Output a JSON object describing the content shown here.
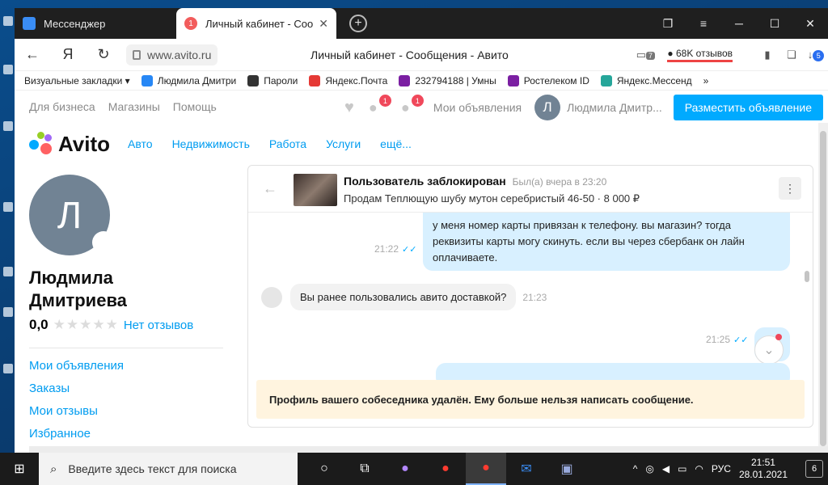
{
  "browser": {
    "tabs": [
      {
        "label": "Мессенджер"
      },
      {
        "label": "Личный кабинет - Coo",
        "badge": "1"
      }
    ],
    "url": "www.avito.ru",
    "yandex_glyph": "Я",
    "page_title": "Личный кабинет - Сообщения - Авито",
    "reviews_badge": "68K отзывов",
    "ext_badge": "7",
    "downloads_badge": "5",
    "bookmarks": [
      {
        "label": "Визуальные закладки ▾",
        "color": ""
      },
      {
        "label": "Людмила Дмитри",
        "color": "#2787f5"
      },
      {
        "label": "Пароли",
        "color": "#333333"
      },
      {
        "label": "Яндекс.Почта",
        "color": "#e53935"
      },
      {
        "label": "232794188 | Умны",
        "color": "#7b1fa2"
      },
      {
        "label": "Ростелеком ID",
        "color": "#7b1fa2"
      },
      {
        "label": "Яндекс.Мессенд",
        "color": "#26a69a"
      }
    ]
  },
  "avito": {
    "top_links": [
      "Для бизнеса",
      "Магазины",
      "Помощь"
    ],
    "notif_badge": "1",
    "msg_badge": "1",
    "my_ads": "Мои объявления",
    "user_initial": "Л",
    "user_name": "Людмила Дмитр...",
    "post_button": "Разместить объявление",
    "logo_text": "Avito",
    "nav": [
      "Авто",
      "Недвижимость",
      "Работа",
      "Услуги",
      "ещё..."
    ],
    "profile": {
      "initial": "Л",
      "name_line1": "Людмила",
      "name_line2": "Дмитриева",
      "rating": "0,0",
      "no_reviews": "Нет отзывов",
      "menu": [
        "Мои объявления",
        "Заказы",
        "Мои отзывы",
        "Избранное"
      ]
    },
    "chat": {
      "title": "Пользователь заблокирован",
      "seen": "Был(а) вчера в 23:20",
      "subtitle": "Продам Теплющую шубу мутон серебристый 46-50 · 8 000 ₽",
      "msg1": "у меня номер карты привязан к телефону. вы магазин? тогда реквизиты карты могу скинуть. если вы через сбербанк он лайн оплачиваете.",
      "msg1_time": "21:22",
      "msg2": "Вы ранее пользовались авито доставкой?",
      "msg2_time": "21:23",
      "msg3_time": "21:25",
      "notice": "Профиль вашего собеседника удалён. Ему больше нельзя написать сообщение."
    }
  },
  "taskbar": {
    "search_placeholder": "Введите здесь текст для поиска",
    "lang": "РУС",
    "time": "21:51",
    "date": "28.01.2021",
    "notifications": "6"
  }
}
